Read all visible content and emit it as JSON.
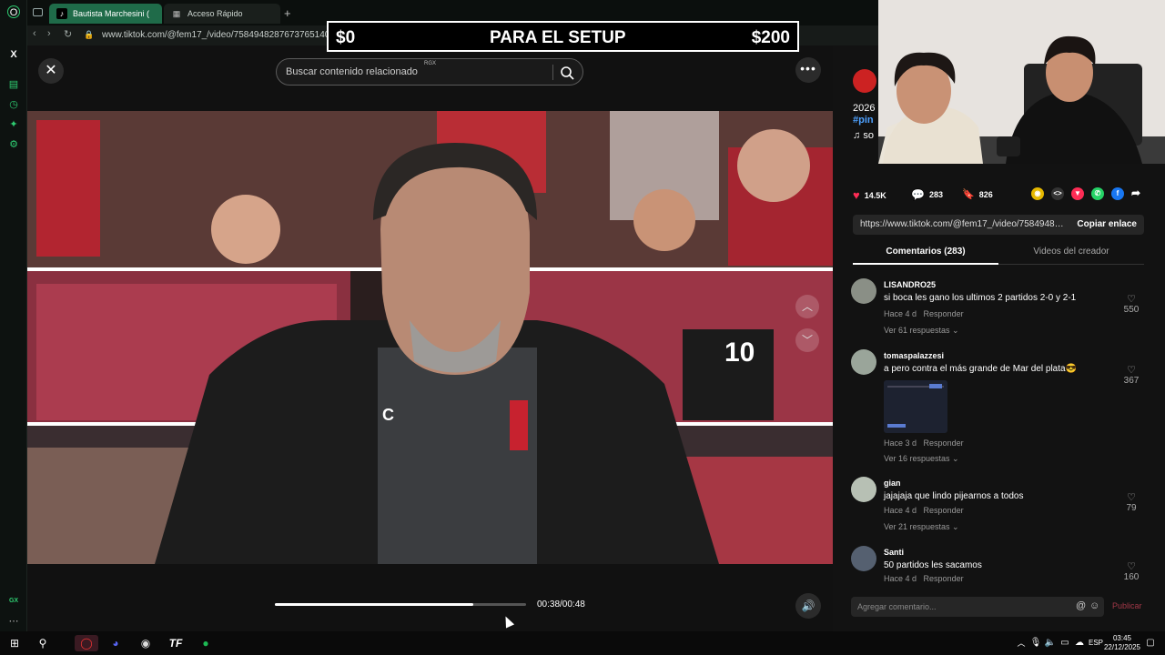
{
  "browser": {
    "tabs": [
      {
        "label": "Bautista Marchesini (",
        "active": true
      },
      {
        "label": "Acceso Rápido",
        "active": false
      }
    ],
    "new_tab_label": "+",
    "url": "www.tiktok.com/@fem17_/video/7584948287673765140",
    "sidebar_bottom_label": "GX"
  },
  "overlay": {
    "left_amount": "$0",
    "title": "PARA EL SETUP",
    "right_amount": "$200"
  },
  "search": {
    "placeholder": "Buscar contenido relacionado",
    "badge": "RGX"
  },
  "player": {
    "time": "00:38/00:48",
    "progress": 0.79
  },
  "author": {
    "year": "2026",
    "hashtag": "#pin",
    "sound": "so"
  },
  "actions": {
    "likes": "14.5K",
    "comments": "283",
    "saves": "826"
  },
  "link": {
    "url": "https://www.tiktok.com/@fem17_/video/75849482...",
    "copy_label": "Copiar enlace"
  },
  "comment_tabs": {
    "comments": "Comentarios (283)",
    "creator_videos": "Videos del creador"
  },
  "comments": [
    {
      "user": "LISANDRO25",
      "text": "si boca les gano los ultimos 2 partidos 2-0 y 2-1",
      "time": "Hace 4 d",
      "reply": "Responder",
      "likes": "550",
      "replies": "Ver 61 respuestas"
    },
    {
      "user": "tomaspalazzesi",
      "text": "a pero contra el más grande de Mar del plata😎",
      "time": "Hace 3 d",
      "reply": "Responder",
      "likes": "367",
      "replies": "Ver 16 respuestas"
    },
    {
      "user": "gian",
      "text": "jajajaja que lindo pijearnos a todos",
      "time": "Hace 4 d",
      "reply": "Responder",
      "likes": "79",
      "replies": "Ver 21 respuestas"
    },
    {
      "user": "Santi",
      "text": "50 partidos les sacamos",
      "time": "Hace 4 d",
      "reply": "Responder",
      "likes": "160",
      "replies": ""
    }
  ],
  "add_comment": {
    "placeholder": "Agregar comentario...",
    "publish_label": "Publicar"
  },
  "taskbar": {
    "language": "ESP",
    "time": "03:45",
    "date": "22/12/2025"
  },
  "colors": {
    "accent": "#fe2c55",
    "browser_green": "#1f6b49",
    "link_blue": "#4ea1ff"
  }
}
